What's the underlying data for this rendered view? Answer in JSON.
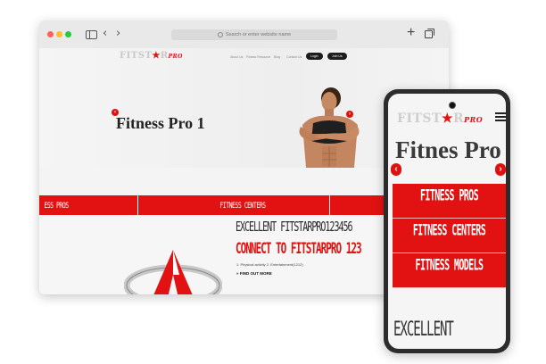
{
  "browser": {
    "address_placeholder": "Search or enter website name",
    "back": "‹",
    "forward": "›",
    "new_tab": "+"
  },
  "site": {
    "logo_main_a": "FITST",
    "logo_star": "★",
    "logo_main_b": "R",
    "logo_pro": "PRO",
    "nav": [
      "About Us",
      "Fitness Resource",
      "Blog",
      "Contact Us"
    ],
    "login": "Login",
    "join": "Join Us",
    "hero_title": "Fitness Pro 1",
    "carousel_prev": "‹",
    "carousel_next": "›",
    "band": [
      "ESS PROS",
      "FITNESS CENTERS"
    ],
    "heading1": "EXCELLENT FITSTARPRO123456",
    "heading2": "CONNECT TO FITSTARPRO 123",
    "list1": "1. Physical activity 2. Entertainment(1212)",
    "cta": "» FIND OUT MORE"
  },
  "mobile": {
    "logo_main_a": "FITST",
    "logo_star": "★",
    "logo_main_b": "R",
    "logo_pro": "PRO",
    "title": "Fitnes Pro",
    "prev": "‹",
    "next": "›",
    "buttons": [
      "FITNESS PROS",
      "FITNESS CENTERS",
      "FITNESS MODELS"
    ],
    "excellent": "EXCELLENT"
  },
  "colors": {
    "brand_red": "#e21212",
    "dark": "#1c1c1c"
  }
}
